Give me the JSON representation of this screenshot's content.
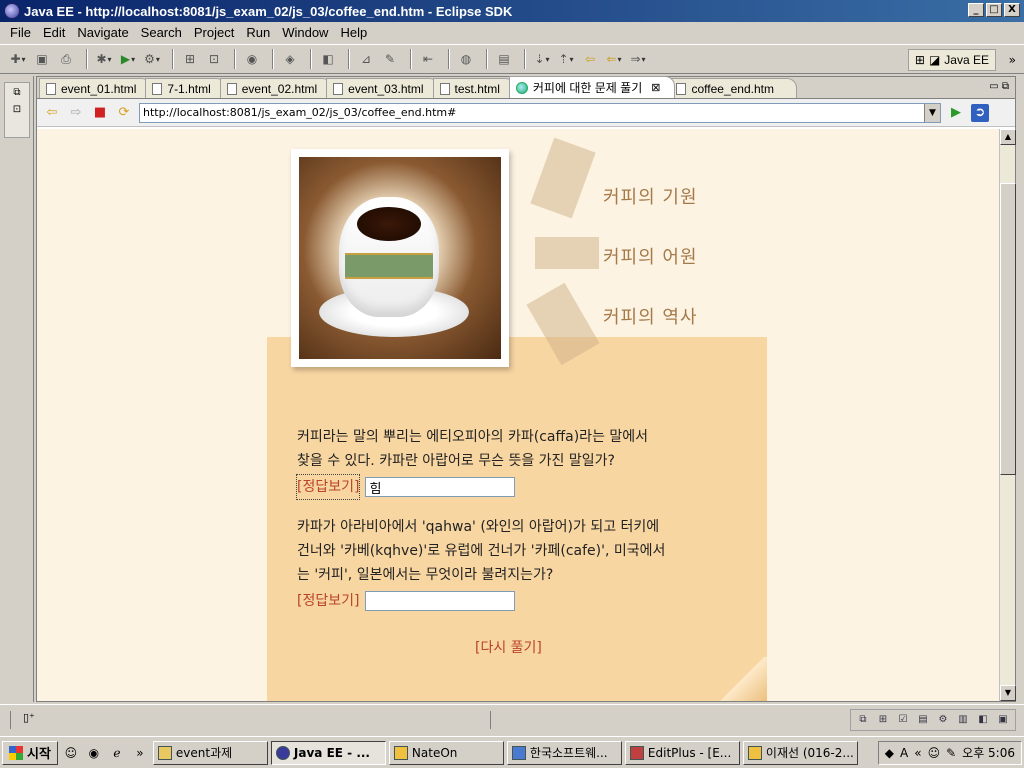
{
  "window": {
    "title": "Java EE - http://localhost:8081/js_exam_02/js_03/coffee_end.htm - Eclipse SDK",
    "minimize": "_",
    "maximize": "□",
    "close": "X"
  },
  "menubar": [
    "File",
    "Edit",
    "Navigate",
    "Search",
    "Project",
    "Run",
    "Window",
    "Help"
  ],
  "perspective": {
    "label": "Java EE",
    "more": "»"
  },
  "tabs": [
    {
      "label": "event_01.html",
      "icon": "file-icon"
    },
    {
      "label": "7-1.html",
      "icon": "file-icon"
    },
    {
      "label": "event_02.html",
      "icon": "file-icon"
    },
    {
      "label": "event_03.html",
      "icon": "file-icon"
    },
    {
      "label": "test.html",
      "icon": "file-icon"
    },
    {
      "label": "커피에 대한 문제 풀기",
      "icon": "globe-icon",
      "active": true
    },
    {
      "label": "coffee_end.htm",
      "icon": "file-icon"
    }
  ],
  "browser": {
    "url": "http://localhost:8081/js_exam_02/js_03/coffee_end.htm#"
  },
  "page": {
    "side_menu": [
      "커피의 기원",
      "커피의 어원",
      "커피의 역사"
    ],
    "q1": {
      "line1": "커피라는 말의 뿌리는 에티오피아의 카파(caffa)라는 말에서",
      "line2": "찾을 수 있다. 카파란 아랍어로 무슨 뜻을 가진 말일가?",
      "button": "[정답보기]",
      "answer": "힘"
    },
    "q2": {
      "line1": "카파가 아라비아에서 'qahwa' (와인의 아랍어)가 되고 터키에",
      "line2": "건너와 '카베(kqhve)'로 유럽에 건너가 '카페(cafe)', 미국에서",
      "line3": "는 '커피', 일본에서는 무엇이라 불려지는가?",
      "button": "[정답보기]",
      "answer": ""
    },
    "retry": "[다시 풀기]"
  },
  "taskbar": {
    "start": "시작",
    "more": "»",
    "buttons": [
      "event과제",
      "Java EE - ...",
      "NateOn",
      "한국소프트웨...",
      "EditPlus - [E...",
      "이재선 (016-2..."
    ],
    "tray_more": "«",
    "clock": "오후 5:06"
  }
}
